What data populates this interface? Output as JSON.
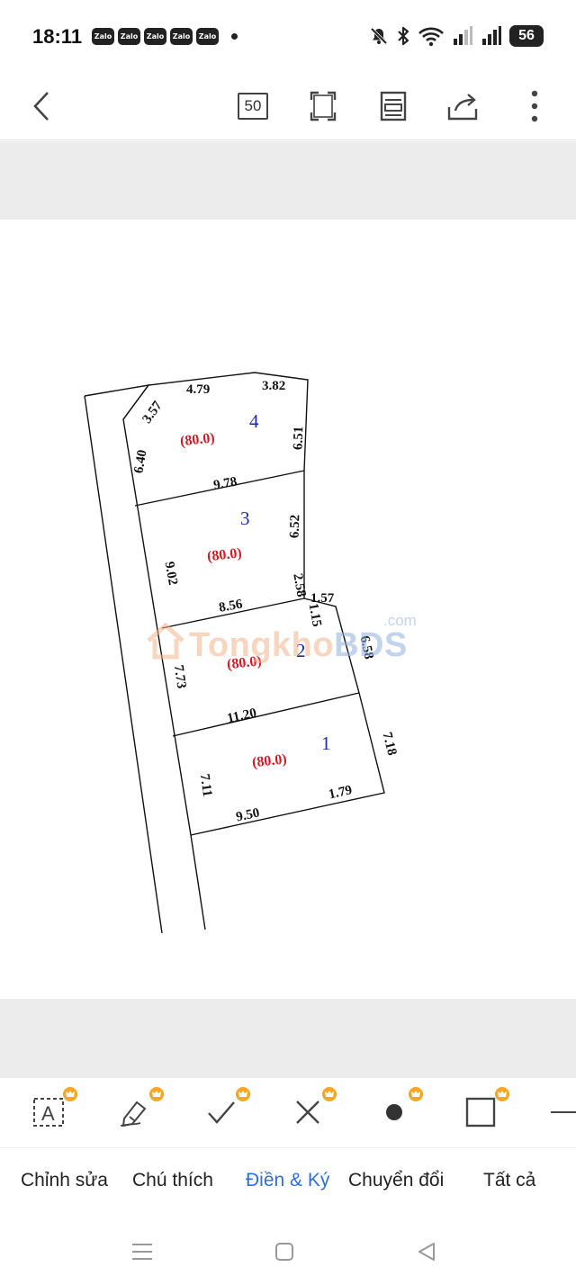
{
  "status_bar": {
    "time": "18:11",
    "notification_apps": [
      "Zalo",
      "Zalo",
      "Zalo",
      "Zalo",
      "Zalo"
    ],
    "battery": "56"
  },
  "toolbar": {
    "page_count": "50"
  },
  "plan": {
    "lots": [
      {
        "number": "1",
        "area": "(80.0)"
      },
      {
        "number": "2",
        "area": "(80.0)"
      },
      {
        "number": "3",
        "area": "(80.0)"
      },
      {
        "number": "4",
        "area": "(80.0)"
      }
    ],
    "dimensions": {
      "d_479": "4.79",
      "d_382": "3.82",
      "d_357": "3.57",
      "d_640": "6.40",
      "d_651": "6.51",
      "d_978": "9.78",
      "d_652": "6.52",
      "d_902": "9.02",
      "d_258": "2.58",
      "d_157": "1.57",
      "d_115": "1.15",
      "d_856": "8.56",
      "d_658": "6.58",
      "d_773": "7.73",
      "d_1120": "11.20",
      "d_718": "7.18",
      "d_711": "7.11",
      "d_950": "9.50",
      "d_179": "1.79"
    }
  },
  "watermark": {
    "part1": "Tongkho",
    "part2": "BDS",
    "suffix": ".com"
  },
  "tools": [
    {
      "icon": "text-box-icon"
    },
    {
      "icon": "pen-icon"
    },
    {
      "icon": "check-icon"
    },
    {
      "icon": "cross-icon"
    },
    {
      "icon": "dot-icon"
    },
    {
      "icon": "rectangle-icon"
    },
    {
      "icon": "line-icon"
    }
  ],
  "tabs": {
    "edit": "Chỉnh sửa",
    "annotate": "Chú thích",
    "fill_sign": "Điền & Ký",
    "convert": "Chuyển đổi",
    "all": "Tất cả"
  },
  "colors": {
    "accent": "#2f6fd4",
    "area_label": "#d01c24",
    "lot_number": "#1b2aa8",
    "premium_badge": "#f5a623"
  }
}
